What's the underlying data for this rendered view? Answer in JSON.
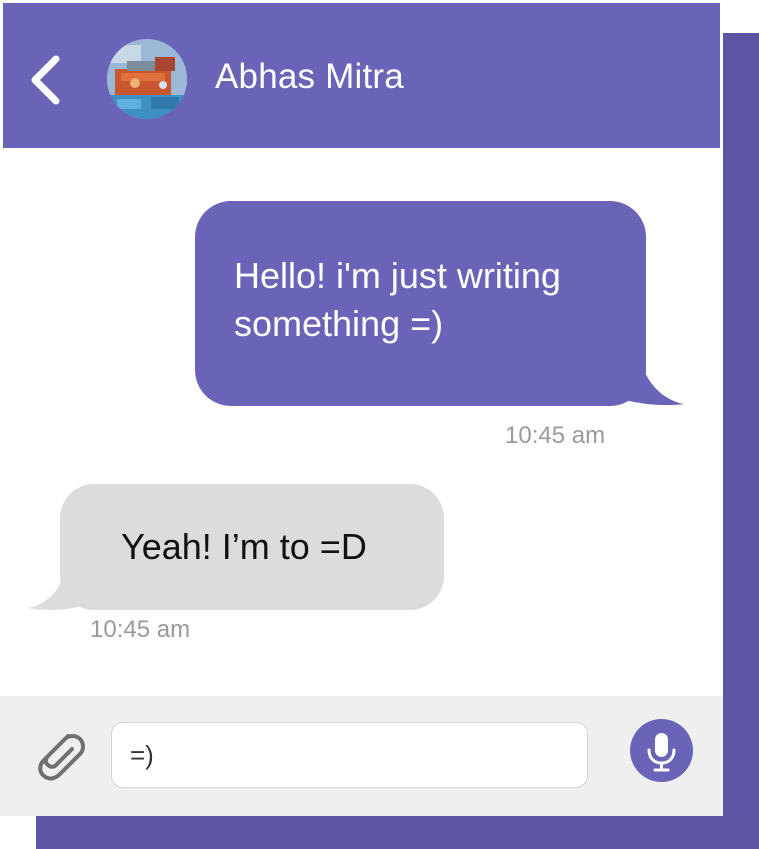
{
  "header": {
    "contact_name": "Abhas Mitra",
    "back_icon": "chevron-left-icon",
    "avatar_icon": "avatar"
  },
  "messages": [
    {
      "direction": "outgoing",
      "text": "Hello! i'm just writing something =)",
      "time": "10:45 am"
    },
    {
      "direction": "incoming",
      "text": "Yeah! I’m to =D",
      "time": "10:45 am"
    }
  ],
  "composer": {
    "input_value": "=)",
    "attach_icon": "paperclip-icon",
    "mic_icon": "microphone-icon"
  },
  "colors": {
    "accent": "#6964b8",
    "backdrop": "#5b55a4",
    "incoming_bubble": "#dcdcdc",
    "timestamp": "#9a9a9a",
    "composer_bg": "#efefef"
  }
}
